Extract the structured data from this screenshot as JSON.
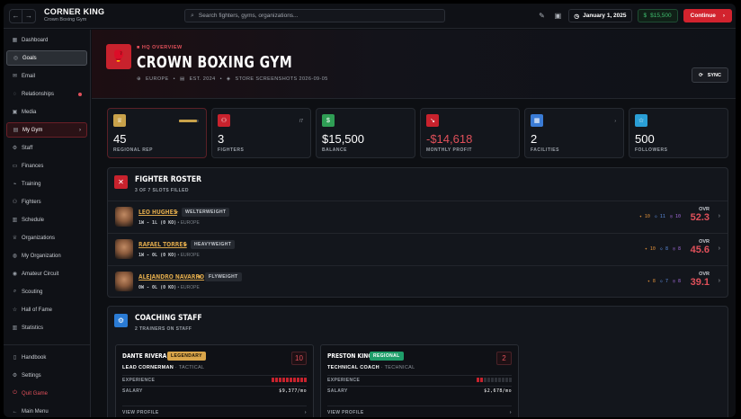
{
  "topbar": {
    "title": "CORNER KING",
    "subtitle": "Crown Boxing Gym",
    "search_placeholder": "Search fighters, gyms, organizations...",
    "date": "January 1, 2025",
    "cash": "$15,500",
    "continue_label": "Continue"
  },
  "sidebar": {
    "items": [
      {
        "label": "Dashboard",
        "icon": "grid-icon"
      },
      {
        "label": "Goals",
        "icon": "target-icon"
      },
      {
        "label": "Email",
        "icon": "mail-icon"
      },
      {
        "label": "Relationships",
        "icon": "chat-icon"
      },
      {
        "label": "Media",
        "icon": "media-icon"
      },
      {
        "label": "My Gym",
        "icon": "gym-icon"
      },
      {
        "label": "Staff",
        "icon": "staff-icon"
      },
      {
        "label": "Finances",
        "icon": "finance-icon"
      },
      {
        "label": "Training",
        "icon": "training-icon"
      },
      {
        "label": "Fighters",
        "icon": "fighters-icon"
      },
      {
        "label": "Schedule",
        "icon": "calendar-icon"
      },
      {
        "label": "Organizations",
        "icon": "trophy-icon"
      },
      {
        "label": "My Organization",
        "icon": "org-icon"
      },
      {
        "label": "Amateur Circuit",
        "icon": "circuit-icon"
      },
      {
        "label": "Scouting",
        "icon": "scout-icon"
      },
      {
        "label": "Hall of Fame",
        "icon": "fame-icon"
      },
      {
        "label": "Statistics",
        "icon": "stats-icon"
      }
    ],
    "bottom": [
      {
        "label": "Handbook",
        "icon": "book-icon"
      },
      {
        "label": "Settings",
        "icon": "gear-icon"
      },
      {
        "label": "Quit Game",
        "icon": "power-icon"
      },
      {
        "label": "Main Menu",
        "icon": "back-icon"
      }
    ]
  },
  "hero": {
    "tag": "HQ OVERVIEW",
    "name": "CROWN BOXING GYM",
    "region": "EUROPE",
    "est": "EST. 2024",
    "store": "STORE SCREENSHOTS 2026-09-05",
    "sync_label": "SYNC"
  },
  "stats": [
    {
      "value": "45",
      "label": "REGIONAL REP",
      "color": "#c9a24a",
      "progress": 0.9
    },
    {
      "value": "3",
      "label": "FIGHTERS",
      "extra": "/7",
      "color": "#c8222d"
    },
    {
      "value": "$15,500",
      "label": "BALANCE",
      "color": "#2f9e55"
    },
    {
      "value": "-$14,618",
      "label": "MONTHLY PROFIT",
      "color": "#c8222d",
      "negative": true
    },
    {
      "value": "2",
      "label": "FACILITIES",
      "extra": "›",
      "color": "#3a7bd5"
    },
    {
      "value": "500",
      "label": "FOLLOWERS",
      "color": "#2a9fd6"
    }
  ],
  "roster": {
    "title": "FIGHTER ROSTER",
    "subtitle": "3 OF 7 SLOTS FILLED",
    "ovr_label": "OVR",
    "fighters": [
      {
        "name": "LEO HUGHES",
        "class": "WELTERWEIGHT",
        "record": "1W - 1L (0 KO)",
        "region": "EUROPE",
        "s1": "10",
        "s2": "11",
        "s3": "10",
        "ovr": "52.3"
      },
      {
        "name": "RAFAEL TORRES",
        "class": "HEAVYWEIGHT",
        "record": "1W - 0L (0 KO)",
        "region": "EUROPE",
        "s1": "10",
        "s2": "8",
        "s3": "8",
        "ovr": "45.6"
      },
      {
        "name": "ALEJANDRO NAVARRO",
        "class": "FLYWEIGHT",
        "record": "0W - 0L (0 KO)",
        "region": "EUROPE",
        "s1": "8",
        "s2": "7",
        "s3": "8",
        "ovr": "39.1"
      }
    ]
  },
  "coaching": {
    "title": "COACHING STAFF",
    "subtitle": "2 TRAINERS ON STAFF",
    "exp_label": "EXPERIENCE",
    "salary_label": "SALARY",
    "view_label": "VIEW PROFILE",
    "trainers": [
      {
        "name": "DANTE RIVERA",
        "tier": "LEGENDARY",
        "tier_bg": "#d9a54a",
        "tier_fg": "#1a1205",
        "level": "10",
        "role": "LEAD CORNERMAN",
        "spec": "TACTICAL",
        "exp": 10,
        "salary": "$9,377/mo"
      },
      {
        "name": "PRESTON KING",
        "tier": "REGIONAL",
        "tier_bg": "#1f9e6a",
        "tier_fg": "#ffffff",
        "level": "2",
        "role": "TECHNICAL COACH",
        "spec": "TECHNICAL",
        "exp": 2,
        "salary": "$2,678/mo"
      }
    ]
  }
}
